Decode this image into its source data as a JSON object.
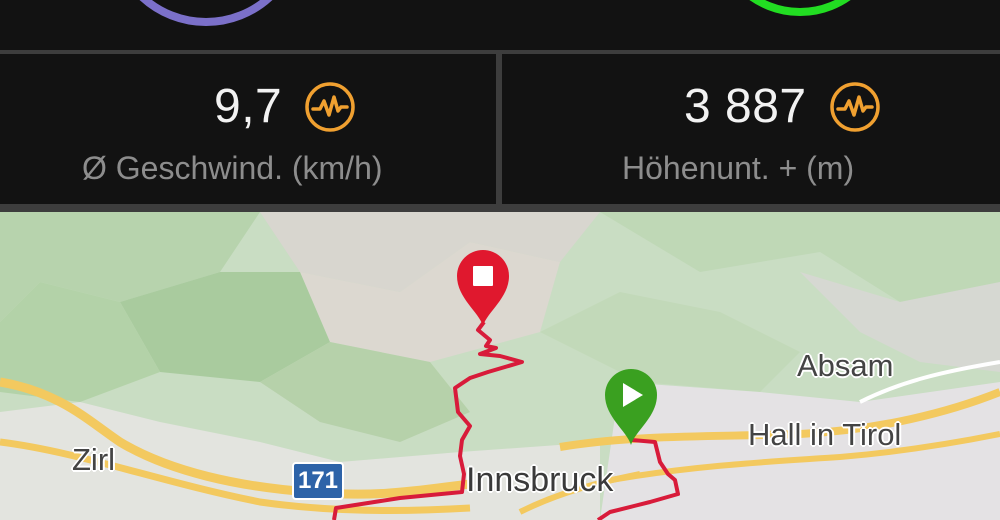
{
  "summary_rings": {
    "left_color": "#7b70c9",
    "right_color": "#22dd22"
  },
  "stats": [
    {
      "value": "9,7",
      "label": "Ø Geschwind. (km/h)",
      "icon": "heart-rate-wave-icon",
      "icon_color": "#f0a030"
    },
    {
      "value": "3 887",
      "label": "Höhenunt. + (m)",
      "icon": "heart-rate-wave-icon",
      "icon_color": "#f0a030"
    }
  ],
  "map": {
    "labels": {
      "absam": "Absam",
      "hall": "Hall in Tirol",
      "zirl": "Zirl",
      "innsbruck": "Innsbruck"
    },
    "road_shield": "171",
    "route_color": "#d81b3a",
    "start_marker": {
      "icon": "play-icon",
      "color": "#3aa020"
    },
    "finish_marker": {
      "icon": "stop-square-icon",
      "color": "#e0182e"
    }
  }
}
